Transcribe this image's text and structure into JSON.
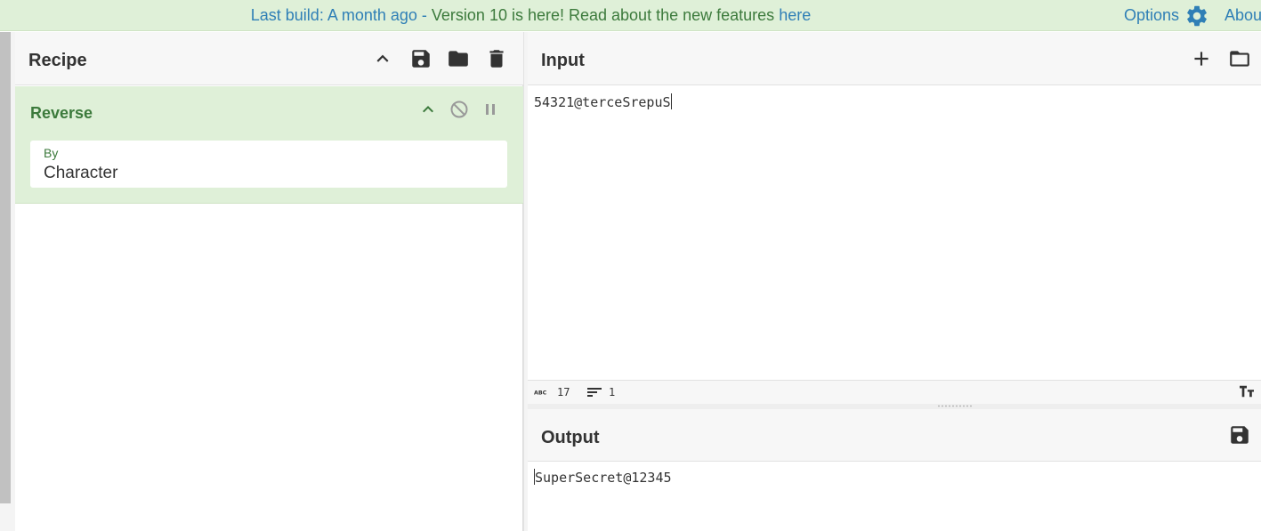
{
  "banner": {
    "prefix": "Last build: A month ago",
    "separator": " - ",
    "version_text": "Version 10 is here! Read about the new features",
    "link_text": "here",
    "options_label": "Options",
    "about_label": "Abou"
  },
  "recipe": {
    "title": "Recipe",
    "icons": [
      "chevron-up-icon",
      "save-icon",
      "folder-icon",
      "trash-icon"
    ],
    "operation": {
      "name": "Reverse",
      "arg_label": "By",
      "arg_value": "Character"
    }
  },
  "input": {
    "title": "Input",
    "text": "54321@terceSrepuS",
    "status": {
      "length": "17",
      "lines": "1"
    }
  },
  "output": {
    "title": "Output",
    "text": "SuperSecret@12345"
  },
  "colors": {
    "banner_bg": "#dff0d8",
    "link": "#2f7fb6",
    "op_green": "#3c7a3c",
    "header_bg": "#f7f7f7"
  }
}
